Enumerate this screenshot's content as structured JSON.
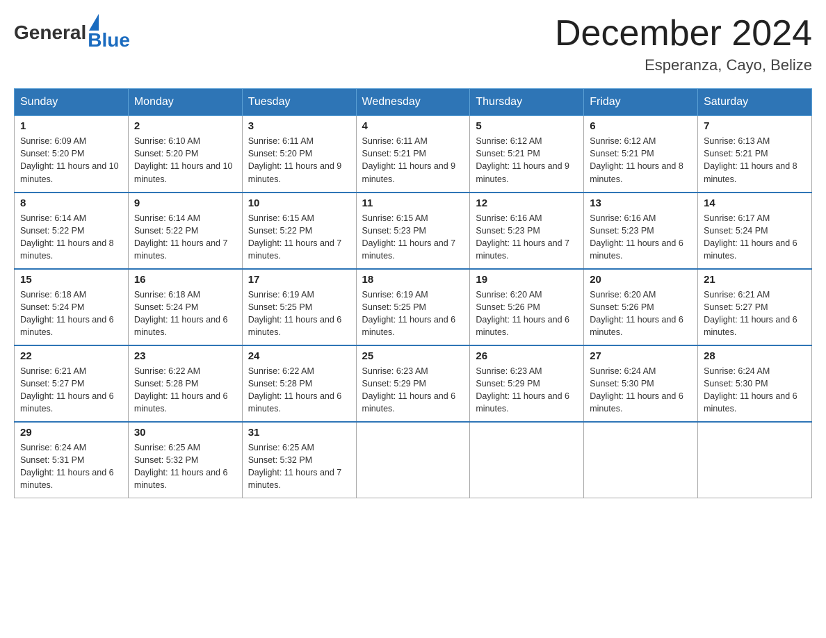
{
  "header": {
    "logo_general": "General",
    "logo_blue": "Blue",
    "title": "December 2024",
    "location": "Esperanza, Cayo, Belize"
  },
  "weekdays": [
    "Sunday",
    "Monday",
    "Tuesday",
    "Wednesday",
    "Thursday",
    "Friday",
    "Saturday"
  ],
  "weeks": [
    [
      {
        "day": "1",
        "sunrise": "6:09 AM",
        "sunset": "5:20 PM",
        "daylight": "11 hours and 10 minutes."
      },
      {
        "day": "2",
        "sunrise": "6:10 AM",
        "sunset": "5:20 PM",
        "daylight": "11 hours and 10 minutes."
      },
      {
        "day": "3",
        "sunrise": "6:11 AM",
        "sunset": "5:20 PM",
        "daylight": "11 hours and 9 minutes."
      },
      {
        "day": "4",
        "sunrise": "6:11 AM",
        "sunset": "5:21 PM",
        "daylight": "11 hours and 9 minutes."
      },
      {
        "day": "5",
        "sunrise": "6:12 AM",
        "sunset": "5:21 PM",
        "daylight": "11 hours and 9 minutes."
      },
      {
        "day": "6",
        "sunrise": "6:12 AM",
        "sunset": "5:21 PM",
        "daylight": "11 hours and 8 minutes."
      },
      {
        "day": "7",
        "sunrise": "6:13 AM",
        "sunset": "5:21 PM",
        "daylight": "11 hours and 8 minutes."
      }
    ],
    [
      {
        "day": "8",
        "sunrise": "6:14 AM",
        "sunset": "5:22 PM",
        "daylight": "11 hours and 8 minutes."
      },
      {
        "day": "9",
        "sunrise": "6:14 AM",
        "sunset": "5:22 PM",
        "daylight": "11 hours and 7 minutes."
      },
      {
        "day": "10",
        "sunrise": "6:15 AM",
        "sunset": "5:22 PM",
        "daylight": "11 hours and 7 minutes."
      },
      {
        "day": "11",
        "sunrise": "6:15 AM",
        "sunset": "5:23 PM",
        "daylight": "11 hours and 7 minutes."
      },
      {
        "day": "12",
        "sunrise": "6:16 AM",
        "sunset": "5:23 PM",
        "daylight": "11 hours and 7 minutes."
      },
      {
        "day": "13",
        "sunrise": "6:16 AM",
        "sunset": "5:23 PM",
        "daylight": "11 hours and 6 minutes."
      },
      {
        "day": "14",
        "sunrise": "6:17 AM",
        "sunset": "5:24 PM",
        "daylight": "11 hours and 6 minutes."
      }
    ],
    [
      {
        "day": "15",
        "sunrise": "6:18 AM",
        "sunset": "5:24 PM",
        "daylight": "11 hours and 6 minutes."
      },
      {
        "day": "16",
        "sunrise": "6:18 AM",
        "sunset": "5:24 PM",
        "daylight": "11 hours and 6 minutes."
      },
      {
        "day": "17",
        "sunrise": "6:19 AM",
        "sunset": "5:25 PM",
        "daylight": "11 hours and 6 minutes."
      },
      {
        "day": "18",
        "sunrise": "6:19 AM",
        "sunset": "5:25 PM",
        "daylight": "11 hours and 6 minutes."
      },
      {
        "day": "19",
        "sunrise": "6:20 AM",
        "sunset": "5:26 PM",
        "daylight": "11 hours and 6 minutes."
      },
      {
        "day": "20",
        "sunrise": "6:20 AM",
        "sunset": "5:26 PM",
        "daylight": "11 hours and 6 minutes."
      },
      {
        "day": "21",
        "sunrise": "6:21 AM",
        "sunset": "5:27 PM",
        "daylight": "11 hours and 6 minutes."
      }
    ],
    [
      {
        "day": "22",
        "sunrise": "6:21 AM",
        "sunset": "5:27 PM",
        "daylight": "11 hours and 6 minutes."
      },
      {
        "day": "23",
        "sunrise": "6:22 AM",
        "sunset": "5:28 PM",
        "daylight": "11 hours and 6 minutes."
      },
      {
        "day": "24",
        "sunrise": "6:22 AM",
        "sunset": "5:28 PM",
        "daylight": "11 hours and 6 minutes."
      },
      {
        "day": "25",
        "sunrise": "6:23 AM",
        "sunset": "5:29 PM",
        "daylight": "11 hours and 6 minutes."
      },
      {
        "day": "26",
        "sunrise": "6:23 AM",
        "sunset": "5:29 PM",
        "daylight": "11 hours and 6 minutes."
      },
      {
        "day": "27",
        "sunrise": "6:24 AM",
        "sunset": "5:30 PM",
        "daylight": "11 hours and 6 minutes."
      },
      {
        "day": "28",
        "sunrise": "6:24 AM",
        "sunset": "5:30 PM",
        "daylight": "11 hours and 6 minutes."
      }
    ],
    [
      {
        "day": "29",
        "sunrise": "6:24 AM",
        "sunset": "5:31 PM",
        "daylight": "11 hours and 6 minutes."
      },
      {
        "day": "30",
        "sunrise": "6:25 AM",
        "sunset": "5:32 PM",
        "daylight": "11 hours and 6 minutes."
      },
      {
        "day": "31",
        "sunrise": "6:25 AM",
        "sunset": "5:32 PM",
        "daylight": "11 hours and 7 minutes."
      },
      null,
      null,
      null,
      null
    ]
  ]
}
